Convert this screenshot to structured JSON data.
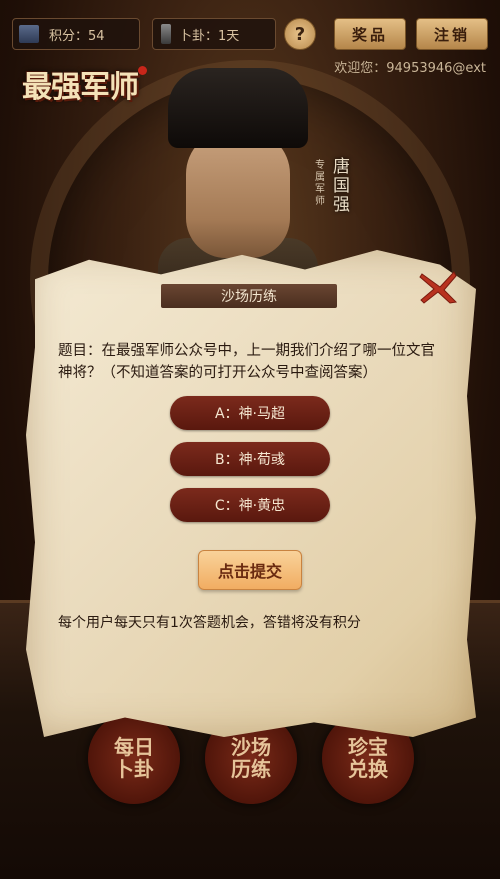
{
  "header": {
    "score_text": "积分：54",
    "divine_text": "卜卦：1天",
    "help_label": "?",
    "prize_label": "奖品",
    "logout_label": "注销",
    "welcome_text": "欢迎您：94953946@ext"
  },
  "logo": {
    "text": "最强军师"
  },
  "general": {
    "name": "唐国强",
    "title": "专属军师"
  },
  "bottom_nav": [
    {
      "label": "每日卜卦"
    },
    {
      "label": "沙场历练"
    },
    {
      "label": "珍宝兑换"
    }
  ],
  "modal": {
    "title": "沙场历练",
    "question": "题目：在最强军师公众号中，上一期我们介绍了哪一位文官神将？（不知道答案的可打开公众号中查阅答案）",
    "options": [
      {
        "label": "A：神·马超"
      },
      {
        "label": "B：神·荀彧"
      },
      {
        "label": "C：神·黄忠"
      }
    ],
    "submit_label": "点击提交",
    "notice": "每个用户每天只有1次答题机会，答错将没有积分"
  },
  "colors": {
    "accent": "#7c2a1c",
    "submit": "#f1ad62",
    "parchment": "#eadbbd",
    "close": "#b8321f"
  }
}
